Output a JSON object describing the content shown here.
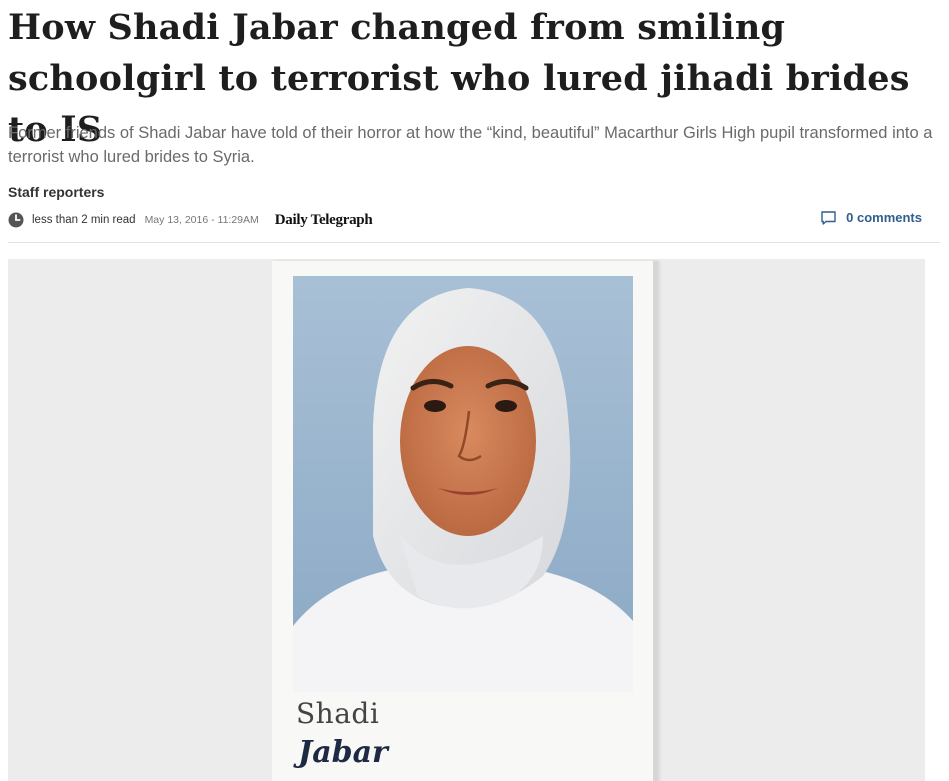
{
  "article": {
    "headline": "How Shadi Jabar changed from smiling schoolgirl to terrorist who lured jihadi brides to IS",
    "standfirst": "Former friends of Shadi Jabar have told of their horror at how the “kind, beautiful” Macarthur Girls High pupil transformed into a terrorist who lured brides to Syria.",
    "byline": "Staff reporters",
    "read_time": "less than 2 min read",
    "timestamp": "May 13, 2016 - 11:29AM",
    "masthead": "Daily Telegraph",
    "comments_label": "0 comments"
  },
  "image": {
    "caption_first": "Shadi",
    "caption_last": "Jabar"
  },
  "icons": {
    "clock": "clock-icon",
    "comment": "comment-icon"
  },
  "colors": {
    "comments_link": "#2f5f8f",
    "headline": "#1e1e1e",
    "standfirst": "#6a6a6a"
  }
}
